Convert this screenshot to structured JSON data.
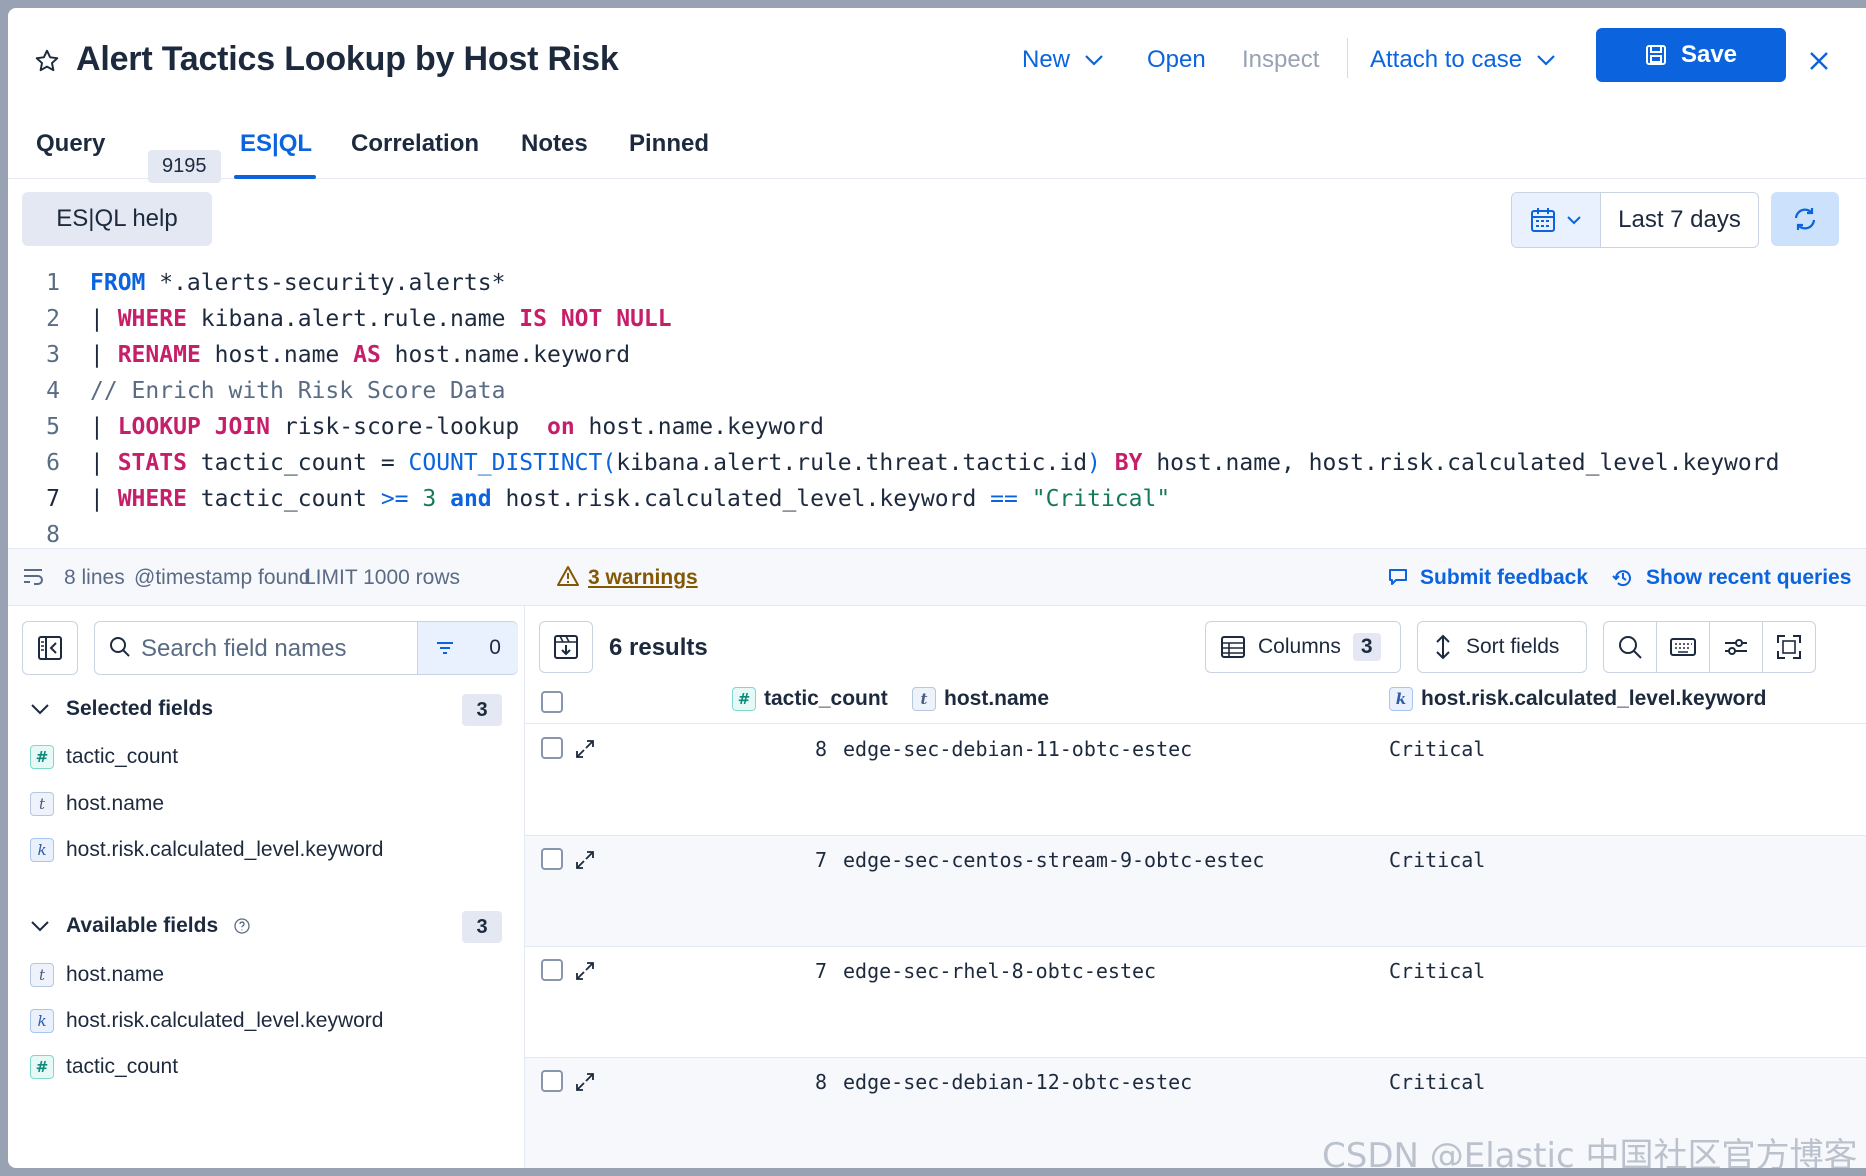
{
  "header": {
    "title": "Alert Tactics Lookup by Host Risk",
    "new_label": "New",
    "open_label": "Open",
    "inspect_label": "Inspect",
    "attach_label": "Attach to case",
    "save_label": "Save"
  },
  "tabs": [
    {
      "label": "Query",
      "count": "9195"
    },
    {
      "label": "ES|QL"
    },
    {
      "label": "Correlation"
    },
    {
      "label": "Notes"
    },
    {
      "label": "Pinned"
    }
  ],
  "editor": {
    "help_label": "ES|QL help",
    "date_range": "Last 7 days",
    "lines": [
      {
        "n": "1",
        "tokens": [
          [
            "kwb",
            "FROM"
          ],
          [
            "txt",
            " *.alerts-security.alerts*"
          ]
        ]
      },
      {
        "n": "2",
        "tokens": [
          [
            "txt",
            "| "
          ],
          [
            "kw",
            "WHERE"
          ],
          [
            "txt",
            " kibana.alert.rule.name "
          ],
          [
            "kw",
            "IS NOT NULL"
          ]
        ]
      },
      {
        "n": "3",
        "tokens": [
          [
            "txt",
            "| "
          ],
          [
            "kw",
            "RENAME"
          ],
          [
            "txt",
            " host.name "
          ],
          [
            "kw",
            "AS"
          ],
          [
            "txt",
            " host.name.keyword"
          ]
        ]
      },
      {
        "n": "4",
        "tokens": [
          [
            "cm",
            "// Enrich with Risk Score Data"
          ]
        ]
      },
      {
        "n": "5",
        "tokens": [
          [
            "txt",
            "| "
          ],
          [
            "kw",
            "LOOKUP JOIN"
          ],
          [
            "txt",
            " risk-score-lookup  "
          ],
          [
            "kw",
            "on"
          ],
          [
            "txt",
            " host.name.keyword"
          ]
        ]
      },
      {
        "n": "6",
        "tokens": [
          [
            "txt",
            "| "
          ],
          [
            "kw",
            "STATS"
          ],
          [
            "txt",
            " tactic_count = "
          ],
          [
            "fn",
            "COUNT_DISTINCT("
          ],
          [
            "txt",
            "kibana.alert.rule.threat.tactic.id"
          ],
          [
            "fn",
            ")"
          ],
          [
            "txt",
            " "
          ],
          [
            "kw",
            "BY"
          ],
          [
            "txt",
            " host.name, host.risk.calculated_level.keyword"
          ]
        ]
      },
      {
        "n": "7",
        "tokens": [
          [
            "txt",
            "| "
          ],
          [
            "kw",
            "WHERE"
          ],
          [
            "txt",
            " tactic_count "
          ],
          [
            "op",
            ">="
          ],
          [
            "txt",
            " "
          ],
          [
            "num",
            "3"
          ],
          [
            "txt",
            " "
          ],
          [
            "kwb",
            "and"
          ],
          [
            "txt",
            " host.risk.calculated_level.keyword "
          ],
          [
            "op",
            "=="
          ],
          [
            "txt",
            " "
          ],
          [
            "str",
            "\"Critical\""
          ]
        ]
      },
      {
        "n": "8",
        "tokens": []
      }
    ]
  },
  "status": {
    "lines": "8 lines",
    "timestamp": "@timestamp found",
    "limit": "LIMIT 1000 rows",
    "warnings": "3 warnings",
    "feedback": "Submit feedback",
    "recent": "Show recent queries"
  },
  "sidebar": {
    "search_placeholder": "Search field names",
    "filter_count": "0",
    "selected_title": "Selected fields",
    "selected_count": "3",
    "selected_fields": [
      {
        "type": "number",
        "name": "tactic_count"
      },
      {
        "type": "text",
        "name": "host.name"
      },
      {
        "type": "keyword",
        "name": "host.risk.calculated_level.keyword"
      }
    ],
    "available_title": "Available fields",
    "available_count": "3",
    "available_fields": [
      {
        "type": "text",
        "name": "host.name"
      },
      {
        "type": "keyword",
        "name": "host.risk.calculated_level.keyword"
      },
      {
        "type": "number",
        "name": "tactic_count"
      }
    ]
  },
  "grid": {
    "results": "6 results",
    "columns_label": "Columns",
    "columns_count": "3",
    "sort_label": "Sort fields",
    "headers": [
      "tactic_count",
      "host.name",
      "host.risk.calculated_level.keyword"
    ],
    "rows": [
      {
        "tactic_count": "8",
        "host": "edge-sec-debian-11-obtc-estec",
        "level": "Critical"
      },
      {
        "tactic_count": "7",
        "host": "edge-sec-centos-stream-9-obtc-estec",
        "level": "Critical"
      },
      {
        "tactic_count": "7",
        "host": "edge-sec-rhel-8-obtc-estec",
        "level": "Critical"
      },
      {
        "tactic_count": "8",
        "host": "edge-sec-debian-12-obtc-estec",
        "level": "Critical"
      }
    ]
  },
  "watermark": "CSDN @Elastic 中国社区官方博客",
  "colors": {
    "primary": "#0b64dd",
    "keyword": "#c61e69",
    "warning": "#825803"
  }
}
